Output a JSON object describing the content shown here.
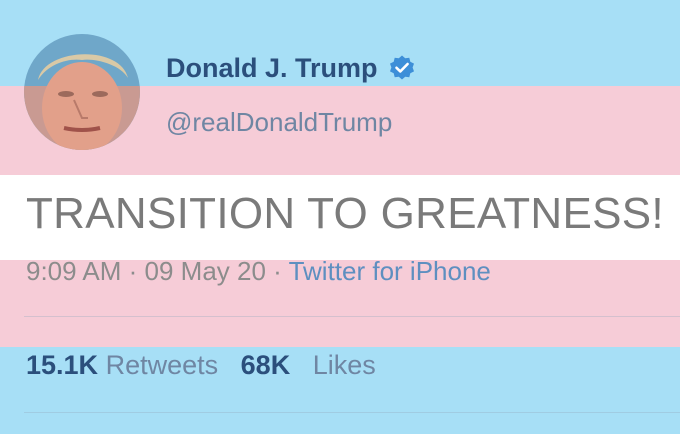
{
  "colors": {
    "flag_blue": "#a7dff6",
    "flag_pink": "#f6ccd7",
    "flag_white": "#ffffff",
    "name_color": "#2b4f7c",
    "verified_badge": "#3d8fd8"
  },
  "tweet": {
    "display_name": "Donald J. Trump",
    "verified_icon": "verified-badge-icon",
    "handle": "@realDonaldTrump",
    "text": "TRANSITION TO GREATNESS!",
    "time": "9:09 AM",
    "separator_1": " · ",
    "date": "09 May 20",
    "separator_2": " · ",
    "source": "Twitter for iPhone"
  },
  "stats": {
    "retweets_count": "15.1K",
    "retweets_label": "Retweets",
    "likes_count": "68K",
    "likes_label": "Likes"
  }
}
